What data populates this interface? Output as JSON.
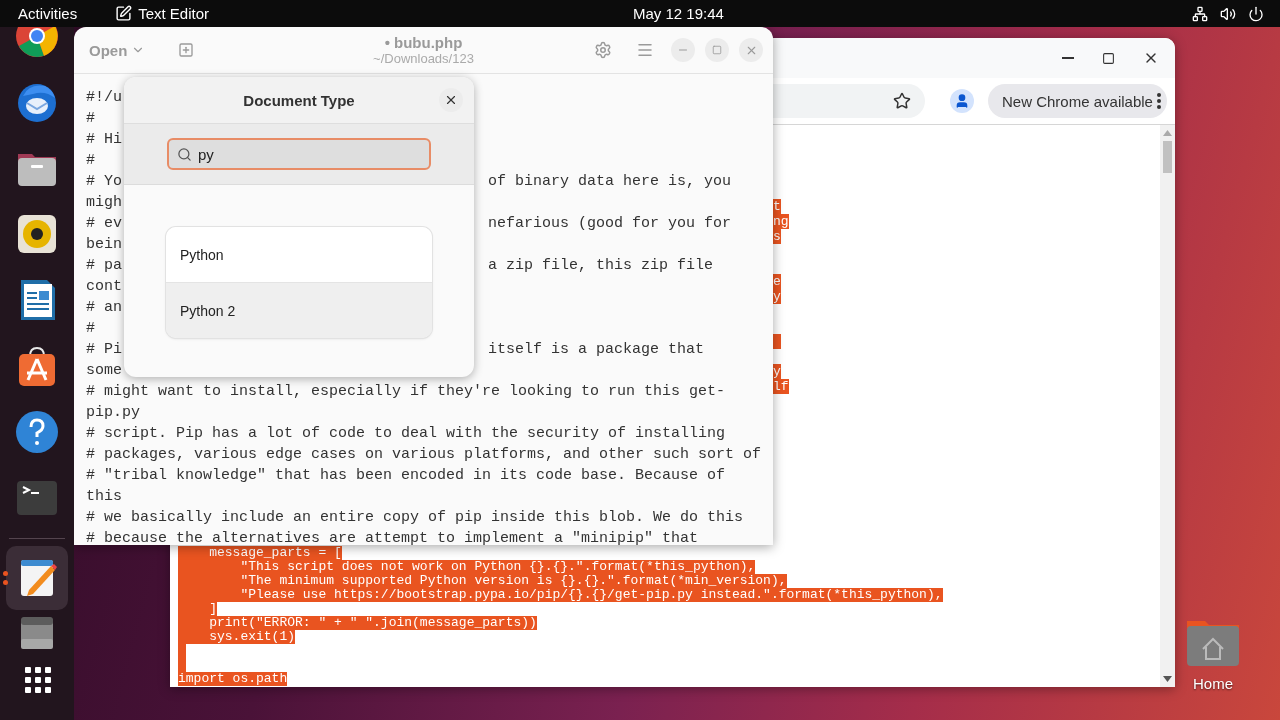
{
  "top_bar": {
    "activities": "Activities",
    "app_name": "Text Editor",
    "clock": "May 12  19:44"
  },
  "dock": {
    "pinned": [
      {
        "kind": "chrome",
        "selected": false
      },
      {
        "kind": "thunderbird",
        "selected": false
      },
      {
        "kind": "files",
        "selected": false
      },
      {
        "kind": "rhythmbox",
        "selected": false
      },
      {
        "kind": "writer",
        "selected": false
      },
      {
        "kind": "app-center",
        "selected": false
      },
      {
        "kind": "help",
        "selected": false
      },
      {
        "kind": "terminal",
        "selected": false
      }
    ],
    "running": [
      {
        "kind": "text-editor",
        "selected": true
      },
      {
        "kind": "drive",
        "selected": false
      },
      {
        "kind": "apps-grid",
        "selected": false
      }
    ]
  },
  "desktop": {
    "icons": [
      {
        "label": "Home"
      }
    ]
  },
  "chrome": {
    "update_button": "New Chrome available",
    "fragments": [
      {
        "kind": "text",
        "text": "t"
      },
      {
        "kind": "text",
        "text": "ng"
      },
      {
        "kind": "text",
        "text": "s"
      },
      {
        "kind": "text",
        "text": "e"
      },
      {
        "kind": "text",
        "text": "y"
      },
      {
        "kind": "blank"
      },
      {
        "kind": "text",
        "text": "y"
      },
      {
        "kind": "text",
        "text": "lf"
      }
    ],
    "code_lines": [
      {
        "kind": "text",
        "text": "    message_parts = ["
      },
      {
        "kind": "text",
        "text": "        \"This script does not work on Python {}.{}.\".format(*this_python),"
      },
      {
        "kind": "text",
        "text": "        \"The minimum supported Python version is {}.{}.\".format(*min_version),"
      },
      {
        "kind": "text",
        "text": "        \"Please use https://bootstrap.pypa.io/pip/{}.{}/get-pip.py instead.\".format(*this_python),"
      },
      {
        "kind": "text",
        "text": "    ]"
      },
      {
        "kind": "text",
        "text": "    print(\"ERROR: \" + \" \".join(message_parts))"
      },
      {
        "kind": "text",
        "text": "    sys.exit(1)"
      },
      {
        "kind": "blank"
      },
      {
        "kind": "blank"
      },
      {
        "kind": "text",
        "text": "import os.path"
      }
    ]
  },
  "editor": {
    "open_button": "Open",
    "title": "• bubu.php",
    "subtitle": "~/Downloads/123",
    "lines": [
      {
        "left": "#!/u"
      },
      {
        "left": "#"
      },
      {
        "left": "# Hi"
      },
      {
        "left": "#"
      },
      {
        "left": "# Yo",
        "right": "of binary data here is, you"
      },
      {
        "left": "migh"
      },
      {
        "left": "# ev",
        "right": "nefarious (good for you for"
      },
      {
        "left": "bein"
      },
      {
        "left": "# pa",
        "right": "a zip file, this zip file"
      },
      {
        "left": "cont"
      },
      {
        "left": "# an"
      },
      {
        "left": "#"
      },
      {
        "left": "# Pi",
        "right": "itself is a package that"
      },
      {
        "left": "some"
      },
      {
        "left": "# might want to install, especially if they're looking to run this get-"
      },
      {
        "left": "pip.py"
      },
      {
        "left": "# script. Pip has a lot of code to deal with the security of installing"
      },
      {
        "left": "# packages, various edge cases on various platforms, and other such sort of"
      },
      {
        "left": "# \"tribal knowledge\" that has been encoded in its code base. Because of"
      },
      {
        "left": "this"
      },
      {
        "left": "# we basically include an entire copy of pip inside this blob. We do this"
      },
      {
        "left": "# because the alternatives are attempt to implement a \"minipip\" that"
      }
    ]
  },
  "popover": {
    "title": "Document Type",
    "search": {
      "value": "py"
    },
    "results": [
      {
        "label": "Python",
        "highlighted": false
      },
      {
        "label": "Python 2",
        "highlighted": true
      }
    ]
  }
}
